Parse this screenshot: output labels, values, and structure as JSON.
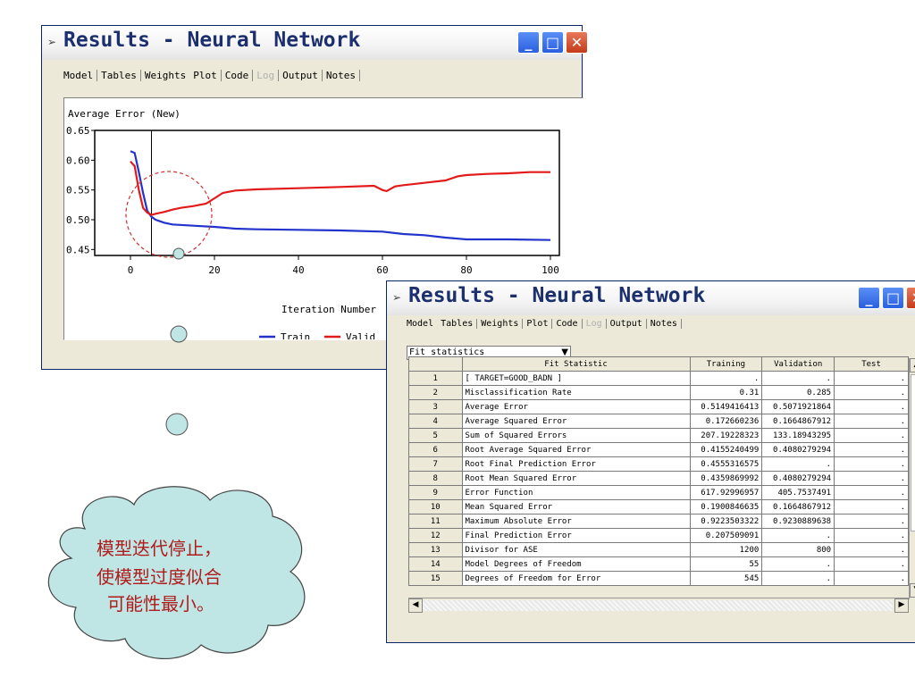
{
  "window1": {
    "title": "Results - Neural Network",
    "tabs": [
      "Model",
      "Tables",
      "Weights",
      "Plot",
      "Code",
      "Log",
      "Output",
      "Notes"
    ],
    "active_tab": "Plot",
    "disabled_tab": "Log"
  },
  "window2": {
    "title": "Results - Neural Network",
    "tabs": [
      "Model",
      "Tables",
      "Weights",
      "Plot",
      "Code",
      "Log",
      "Output",
      "Notes"
    ],
    "disabled_tab": "Log",
    "dropdown_value": "Fit statistics",
    "table": {
      "headers": [
        "",
        "Fit Statistic",
        "Training",
        "Validation",
        "Test"
      ],
      "rows": [
        [
          "1",
          "[ TARGET=GOOD_BADN ]",
          ".",
          ".",
          "."
        ],
        [
          "2",
          "Misclassification Rate",
          "0.31",
          "0.285",
          "."
        ],
        [
          "3",
          "Average Error",
          "0.5149416413",
          "0.5071921864",
          "."
        ],
        [
          "4",
          "Average Squared Error",
          "0.172660236",
          "0.1664867912",
          "."
        ],
        [
          "5",
          "Sum of Squared Errors",
          "207.19228323",
          "133.18943295",
          "."
        ],
        [
          "6",
          "Root Average Squared Error",
          "0.4155240499",
          "0.4080279294",
          "."
        ],
        [
          "7",
          "Root Final Prediction Error",
          "0.4555316575",
          ".",
          "."
        ],
        [
          "8",
          "Root Mean Squared Error",
          "0.4359869992",
          "0.4080279294",
          "."
        ],
        [
          "9",
          "Error Function",
          "617.92996957",
          "405.7537491",
          "."
        ],
        [
          "10",
          "Mean Squared Error",
          "0.1900846635",
          "0.1664867912",
          "."
        ],
        [
          "11",
          "Maximum Absolute Error",
          "0.9223503322",
          "0.9230889638",
          "."
        ],
        [
          "12",
          "Final Prediction Error",
          "0.207509091",
          ".",
          "."
        ],
        [
          "13",
          "Divisor for ASE",
          "1200",
          "800",
          "."
        ],
        [
          "14",
          "Model Degrees of Freedom",
          "55",
          ".",
          "."
        ],
        [
          "15",
          "Degrees of Freedom for Error",
          "545",
          ".",
          "."
        ]
      ]
    }
  },
  "chart_data": {
    "type": "line",
    "title": "Average Error (New)",
    "xlabel": "Iteration Number",
    "ylabel": "",
    "xlim": [
      0,
      100
    ],
    "ylim": [
      0.45,
      0.65
    ],
    "xticks": [
      0,
      20,
      40,
      60,
      80,
      100
    ],
    "yticks": [
      0.45,
      0.5,
      0.55,
      0.6,
      0.65
    ],
    "ytick_labels": [
      "0.45",
      "0.50",
      "0.55",
      "0.60",
      "0.65"
    ],
    "selected_iteration": 5,
    "legend_position": "bottom-right",
    "series": [
      {
        "name": "Train",
        "color": "#2233cc",
        "x": [
          0,
          1,
          2,
          3,
          4,
          5,
          6,
          8,
          10,
          15,
          20,
          25,
          30,
          40,
          50,
          60,
          65,
          70,
          75,
          80,
          90,
          100
        ],
        "y": [
          0.615,
          0.612,
          0.58,
          0.545,
          0.515,
          0.505,
          0.5,
          0.495,
          0.492,
          0.49,
          0.488,
          0.485,
          0.484,
          0.483,
          0.482,
          0.48,
          0.476,
          0.474,
          0.47,
          0.467,
          0.467,
          0.466
        ]
      },
      {
        "name": "Valid",
        "color": "#e21a1a",
        "x": [
          0,
          1,
          2,
          3,
          4,
          5,
          6,
          8,
          10,
          12,
          15,
          18,
          20,
          22,
          25,
          30,
          40,
          50,
          58,
          60,
          61,
          63,
          65,
          70,
          75,
          78,
          80,
          85,
          90,
          95,
          100
        ],
        "y": [
          0.598,
          0.59,
          0.55,
          0.52,
          0.512,
          0.508,
          0.51,
          0.513,
          0.517,
          0.52,
          0.523,
          0.527,
          0.536,
          0.545,
          0.549,
          0.551,
          0.553,
          0.555,
          0.557,
          0.55,
          0.548,
          0.556,
          0.558,
          0.562,
          0.566,
          0.573,
          0.575,
          0.577,
          0.578,
          0.58,
          0.58
        ]
      }
    ]
  },
  "annotation": {
    "lines": [
      "模型迭代停止，",
      "使模型过度似合",
      "可能性最小。"
    ],
    "cloud_color": "#bfe5e4",
    "ring_color": "#cc3333"
  }
}
